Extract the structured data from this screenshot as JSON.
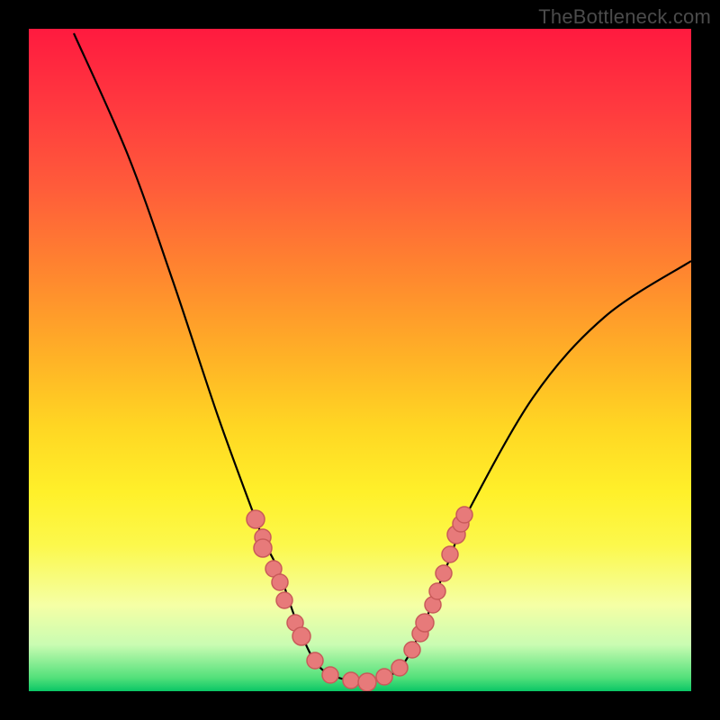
{
  "watermark": "TheBottleneck.com",
  "chart_data": {
    "type": "line",
    "title": "",
    "xlabel": "",
    "ylabel": "",
    "x_range": [
      0,
      736
    ],
    "y_range_inverted": [
      0,
      736
    ],
    "series": [
      {
        "name": "curve",
        "points": [
          [
            50,
            5
          ],
          [
            110,
            140
          ],
          [
            160,
            280
          ],
          [
            210,
            430
          ],
          [
            252,
            545
          ],
          [
            260,
            565
          ],
          [
            264,
            575
          ],
          [
            272,
            590
          ],
          [
            279,
            605
          ],
          [
            284,
            620
          ],
          [
            289,
            635
          ],
          [
            296,
            655
          ],
          [
            303,
            673
          ],
          [
            315,
            698
          ],
          [
            330,
            715
          ],
          [
            355,
            724
          ],
          [
            376,
            726
          ],
          [
            395,
            721
          ],
          [
            410,
            713
          ],
          [
            420,
            700
          ],
          [
            428,
            685
          ],
          [
            435,
            670
          ],
          [
            442,
            655
          ],
          [
            449,
            635
          ],
          [
            455,
            620
          ],
          [
            461,
            605
          ],
          [
            468,
            588
          ],
          [
            475,
            568
          ],
          [
            482,
            548
          ],
          [
            560,
            410
          ],
          [
            640,
            320
          ],
          [
            736,
            258
          ]
        ]
      },
      {
        "name": "dots",
        "points": [
          [
            252,
            545
          ],
          [
            260,
            565
          ],
          [
            260,
            577
          ],
          [
            272,
            600
          ],
          [
            279,
            615
          ],
          [
            284,
            635
          ],
          [
            296,
            660
          ],
          [
            303,
            675
          ],
          [
            318,
            702
          ],
          [
            335,
            718
          ],
          [
            358,
            724
          ],
          [
            376,
            726
          ],
          [
            395,
            720
          ],
          [
            412,
            710
          ],
          [
            426,
            690
          ],
          [
            435,
            672
          ],
          [
            440,
            660
          ],
          [
            449,
            640
          ],
          [
            454,
            625
          ],
          [
            461,
            605
          ],
          [
            468,
            584
          ],
          [
            475,
            562
          ],
          [
            480,
            550
          ],
          [
            484,
            540
          ]
        ],
        "radius_pattern": [
          10,
          9,
          10,
          9,
          9,
          9,
          9,
          10,
          9,
          9,
          9,
          10,
          9,
          9,
          9,
          9,
          10,
          9,
          9,
          9,
          9,
          10,
          9,
          9
        ]
      }
    ],
    "background_gradient": {
      "type": "vertical",
      "stops": [
        {
          "color": "#ff1a3f",
          "pos": 0.0
        },
        {
          "color": "#ff3a3f",
          "pos": 0.12
        },
        {
          "color": "#ff5c3a",
          "pos": 0.24
        },
        {
          "color": "#ff8a2e",
          "pos": 0.38
        },
        {
          "color": "#ffb326",
          "pos": 0.5
        },
        {
          "color": "#ffd623",
          "pos": 0.6
        },
        {
          "color": "#fff02a",
          "pos": 0.7
        },
        {
          "color": "#fcf84c",
          "pos": 0.78
        },
        {
          "color": "#f5ffa5",
          "pos": 0.87
        },
        {
          "color": "#c9fcb2",
          "pos": 0.93
        },
        {
          "color": "#52e07a",
          "pos": 0.98
        },
        {
          "color": "#0ac666",
          "pos": 1.0
        }
      ]
    },
    "border": {
      "color": "#000000",
      "width": 32
    }
  }
}
